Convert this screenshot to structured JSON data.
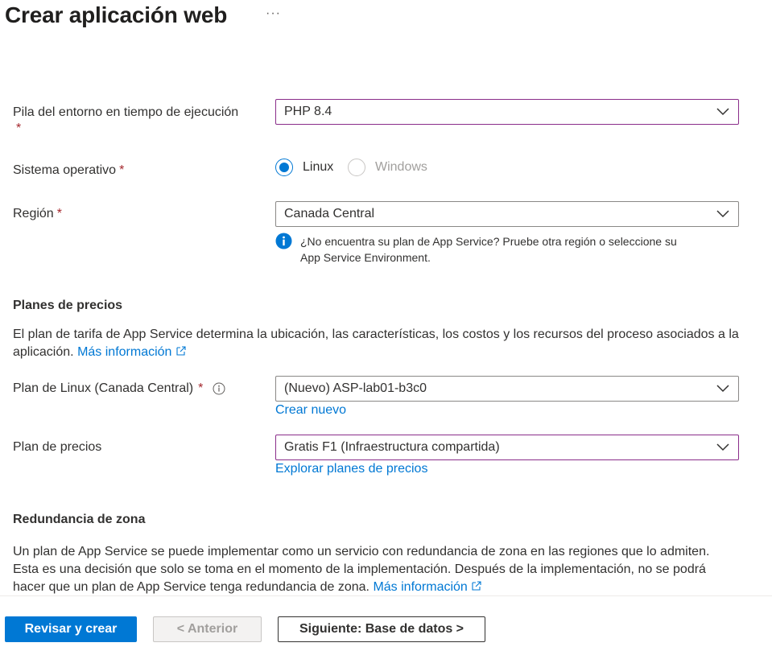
{
  "header": {
    "title": "Crear aplicación web",
    "more_label": "···"
  },
  "runtime": {
    "label": "Pila del entorno en tiempo de ejecución",
    "required_mark": "*",
    "value": "PHP 8.4"
  },
  "os": {
    "label": "Sistema operativo",
    "required_mark": "*",
    "options": [
      {
        "label": "Linux",
        "selected": true,
        "enabled": true
      },
      {
        "label": "Windows",
        "selected": false,
        "enabled": false
      }
    ]
  },
  "region": {
    "label": "Región",
    "required_mark": "*",
    "value": "Canada Central",
    "info_line1": "¿No encuentra su plan de App Service? Pruebe otra región o seleccione su",
    "info_line2": "App Service Environment."
  },
  "pricing_plans": {
    "title": "Planes de precios",
    "description": "El plan de tarifa de App Service determina la ubicación, las características, los costos y los recursos del proceso asociados a la aplicación.",
    "learn_more": "Más información"
  },
  "linux_plan": {
    "label": "Plan de Linux (Canada Central)",
    "required_mark": "*",
    "value": "(Nuevo) ASP-lab01-b3c0",
    "create_new": "Crear nuevo"
  },
  "pricing_plan": {
    "label": "Plan de precios",
    "value": "Gratis F1 (Infraestructura compartida)",
    "explore": "Explorar planes de precios"
  },
  "zone_redundancy": {
    "title": "Redundancia de zona",
    "description": "Un plan de App Service se puede implementar como un servicio con redundancia de zona en las regiones que lo admiten. Esta es una decisión que solo se toma en el momento de la implementación. Después de la implementación, no se podrá hacer que un plan de App Service tenga redundancia de zona.",
    "learn_more": "Más información"
  },
  "footer": {
    "review_create": "Revisar y crear",
    "previous": "< Anterior",
    "next": "Siguiente: Base de datos >"
  },
  "colors": {
    "accent": "#0078d4",
    "required": "#a4262c",
    "focused_border": "#8a2d8a"
  }
}
